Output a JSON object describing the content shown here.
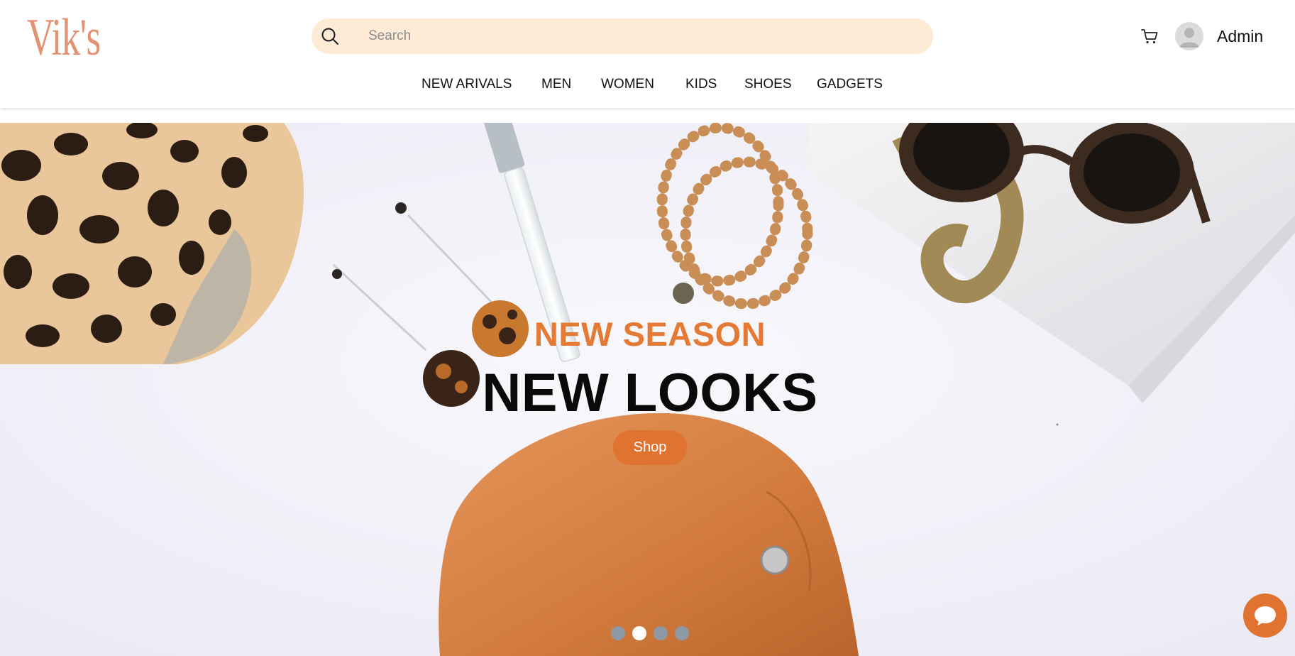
{
  "brand": {
    "logo_text": "Vik's",
    "accent_color": "#e0732f",
    "logo_color": "#e39274"
  },
  "search": {
    "placeholder": "Search",
    "value": "",
    "icon": "search-icon"
  },
  "header": {
    "cart_icon": "cart-icon",
    "avatar_icon": "user-avatar-icon",
    "user_name": "Admin"
  },
  "nav": {
    "items": [
      {
        "label": "NEW ARIVALS"
      },
      {
        "label": "MEN"
      },
      {
        "label": "WOMEN"
      },
      {
        "label": "KIDS"
      },
      {
        "label": "SHOES"
      },
      {
        "label": "GADGETS"
      }
    ]
  },
  "hero": {
    "subtitle": "NEW SEASON",
    "title": "NEW LOOKS",
    "button_label": "Shop",
    "slides_total": 4,
    "active_slide": 2
  },
  "chat": {
    "icon": "chat-bubble-icon"
  }
}
